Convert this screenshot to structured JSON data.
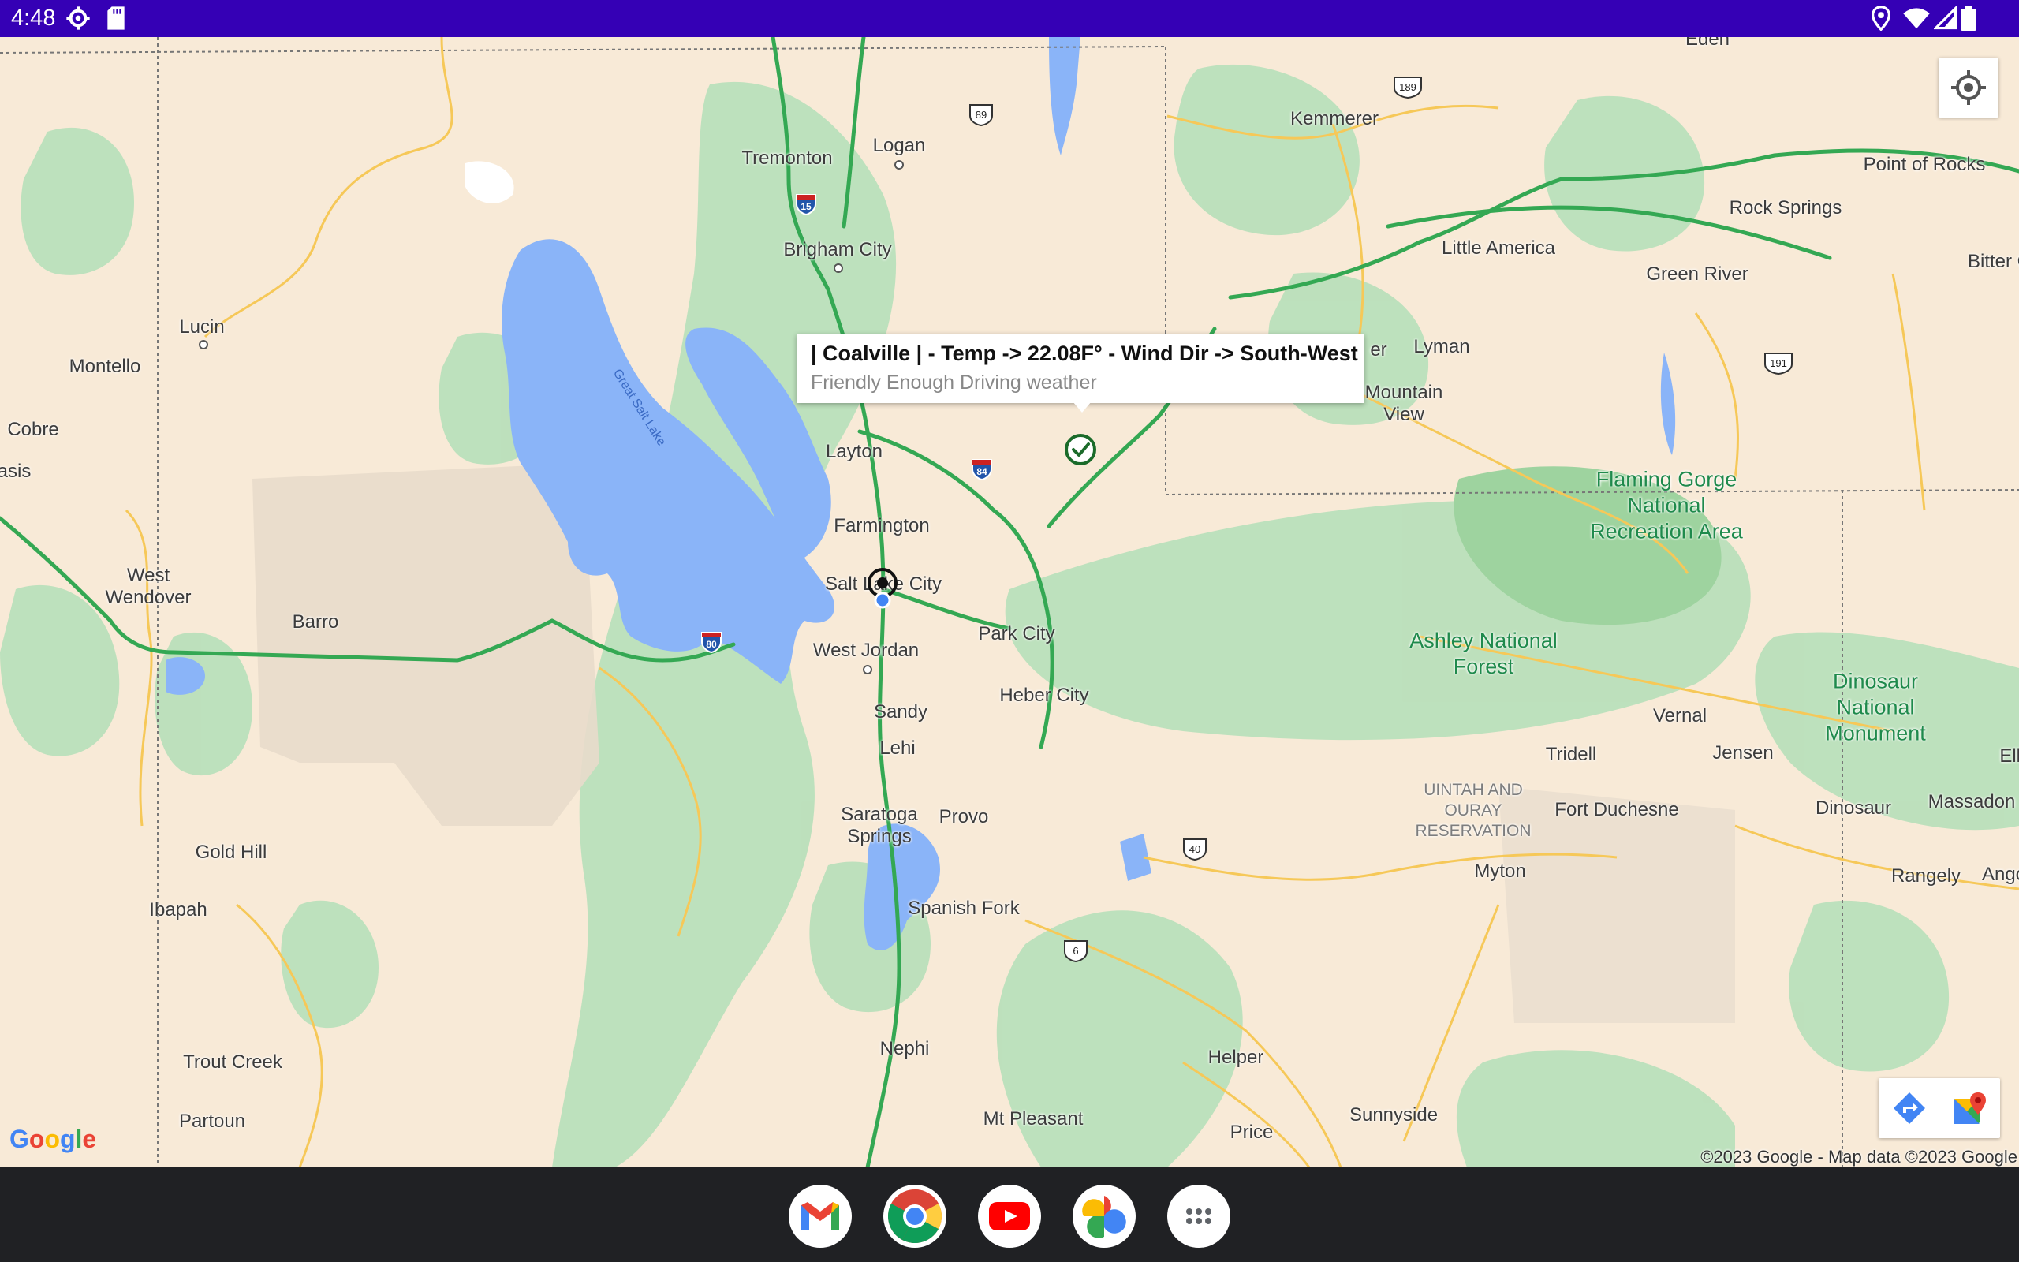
{
  "status_bar": {
    "time": "4:48",
    "icons": [
      "settings-gear-icon",
      "sd-card-icon",
      "location-pin-icon",
      "wifi-icon",
      "signal-icon",
      "battery-icon"
    ]
  },
  "map": {
    "info_window": {
      "title": "| Coalville | - Temp -> 22.08F° - Wind Dir -> South-West",
      "subtitle": "Friendly Enough Driving weather"
    },
    "places": [
      {
        "name": "Eden"
      },
      {
        "name": "Logan"
      },
      {
        "name": "Tremonton"
      },
      {
        "name": "Brigham City"
      },
      {
        "name": "Kemmerer"
      },
      {
        "name": "Point of Rocks"
      },
      {
        "name": "Rock Springs"
      },
      {
        "name": "Little America"
      },
      {
        "name": "Green River"
      },
      {
        "name": "Bitter C"
      },
      {
        "name": "Lucin"
      },
      {
        "name": "Montello"
      },
      {
        "name": "Cobre"
      },
      {
        "name": "asis"
      },
      {
        "name": "Layton"
      },
      {
        "name": "er"
      },
      {
        "name": "Lyman"
      },
      {
        "name": "Mountain View"
      },
      {
        "name": "Farmington"
      },
      {
        "name": "Salt Lake City"
      },
      {
        "name": "West Wendover"
      },
      {
        "name": "Barro"
      },
      {
        "name": "West Jordan"
      },
      {
        "name": "Park City"
      },
      {
        "name": "Heber City"
      },
      {
        "name": "Sandy"
      },
      {
        "name": "Lehi"
      },
      {
        "name": "Saratoga Springs"
      },
      {
        "name": "Provo"
      },
      {
        "name": "Spanish Fork"
      },
      {
        "name": "Vernal"
      },
      {
        "name": "Tridell"
      },
      {
        "name": "Jensen"
      },
      {
        "name": "Elk"
      },
      {
        "name": "Fort Duchesne"
      },
      {
        "name": "Dinosaur"
      },
      {
        "name": "Massadon"
      },
      {
        "name": "Myton"
      },
      {
        "name": "Rangely"
      },
      {
        "name": "Angor"
      },
      {
        "name": "Gold Hill"
      },
      {
        "name": "Ibapah"
      },
      {
        "name": "Trout Creek"
      },
      {
        "name": "Partoun"
      },
      {
        "name": "Nephi"
      },
      {
        "name": "Helper"
      },
      {
        "name": "Sunnyside"
      },
      {
        "name": "Price"
      },
      {
        "name": "Mt Pleasant"
      }
    ],
    "green_areas": [
      "Flaming Gorge National Recreation Area",
      "Ashley National Forest",
      "Dinosaur National Monument"
    ],
    "reservation": "UINTAH AND OURAY RESERVATION",
    "water_label": "Great Salt Lake",
    "shields": [
      "15",
      "89",
      "189",
      "84",
      "191",
      "80",
      "40",
      "6"
    ],
    "copyright": "©2023 Google - Map data ©2023 Google",
    "logo": "Google"
  },
  "dock": {
    "apps": [
      "Gmail",
      "Chrome",
      "YouTube",
      "Photos",
      "App drawer"
    ]
  }
}
